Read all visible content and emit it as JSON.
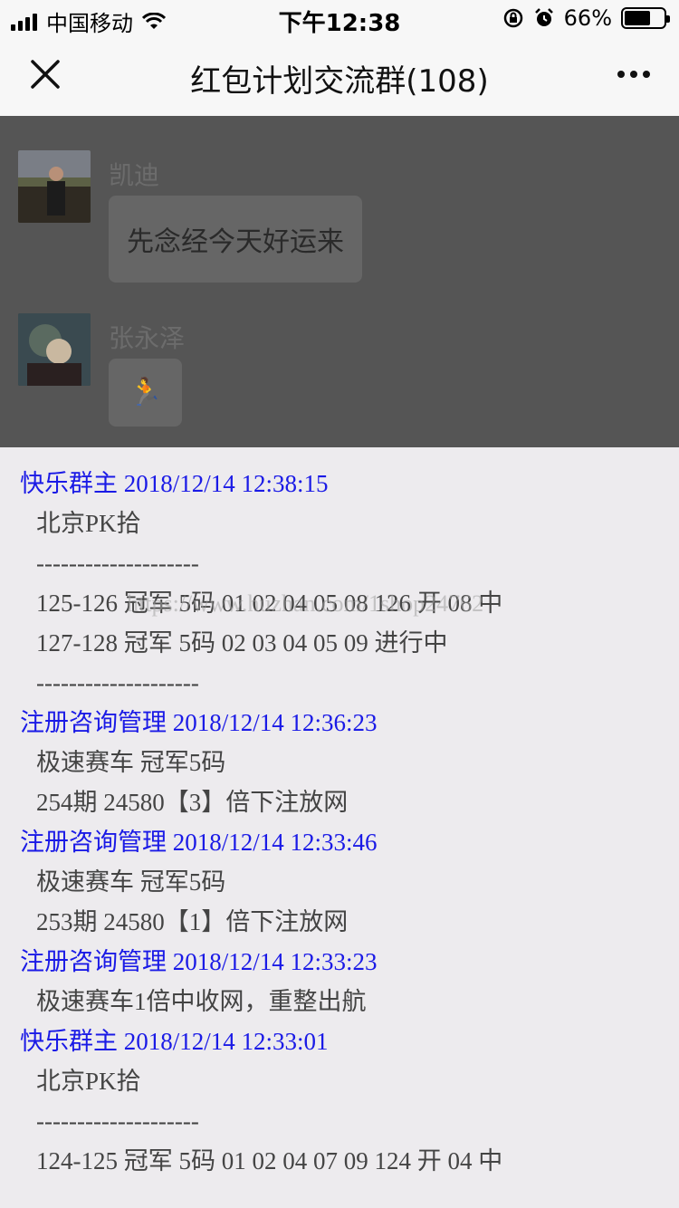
{
  "status_bar": {
    "carrier": "中国移动",
    "time": "下午12:38",
    "battery_percent": "66%",
    "battery_level": 0.66,
    "icons": [
      "signal-icon",
      "wifi-icon",
      "rotation-lock-icon",
      "alarm-icon",
      "battery-icon"
    ]
  },
  "titlebar": {
    "title": "红包计划交流群(108)",
    "close_icon": "close-icon",
    "more_icon": "more-icon"
  },
  "chat": {
    "messages": [
      {
        "sender": "凯迪",
        "text": "先念经今天好运来"
      },
      {
        "sender": "张永泽",
        "text": "🏃"
      }
    ]
  },
  "panel": {
    "watermark": "https://www.huzhan.com/1shop24762",
    "entries": [
      {
        "header": "快乐群主 2018/12/14 12:38:15",
        "lines": [
          "北京PK拾",
          "--------------------",
          "125-126 冠军 5码 01 02 04 05 08 126 开 08 中",
          "127-128 冠军 5码 02 03 04 05 09 进行中",
          "--------------------"
        ]
      },
      {
        "header": "注册咨询管理 2018/12/14 12:36:23",
        "lines": [
          "极速赛车 冠军5码",
          "254期 24580【3】倍下注放网"
        ]
      },
      {
        "header": "注册咨询管理 2018/12/14 12:33:46",
        "lines": [
          "极速赛车 冠军5码",
          "253期 24580【1】倍下注放网"
        ]
      },
      {
        "header": "注册咨询管理 2018/12/14 12:33:23",
        "lines": [
          "极速赛车1倍中收网，重整出航"
        ]
      },
      {
        "header": "快乐群主 2018/12/14 12:33:01",
        "lines": [
          "北京PK拾",
          "--------------------",
          "124-125 冠军 5码 01 02 04 07 09 124 开 04 中"
        ]
      }
    ]
  }
}
